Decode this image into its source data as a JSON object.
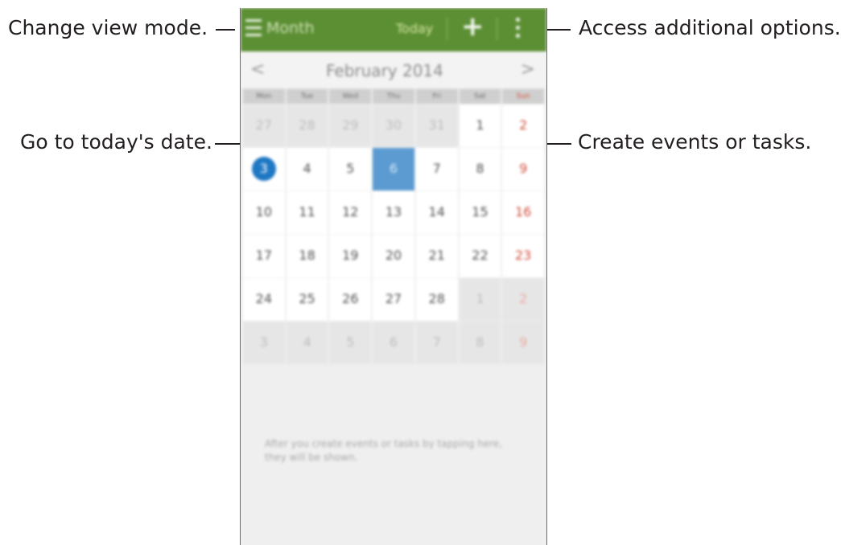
{
  "callouts": {
    "view_mode": "Change view mode.",
    "today": "Go to today's date.",
    "more_options": "Access additional options.",
    "create": "Create events or tasks."
  },
  "action_bar": {
    "view_label": "Month",
    "today_label": "Today",
    "add_icon": "plus-icon",
    "menu_icon": "hamburger-icon",
    "more_icon": "more-vertical-icon",
    "color": "#5c8f34"
  },
  "month_bar": {
    "label": "February 2014",
    "prev": "<",
    "next": ">"
  },
  "weekdays": [
    "Mon",
    "Tue",
    "Wed",
    "Thu",
    "Fri",
    "Sat",
    "Sun"
  ],
  "weeks": [
    [
      "27",
      "28",
      "29",
      "30",
      "31",
      "1",
      "2"
    ],
    [
      "3",
      "4",
      "5",
      "6",
      "7",
      "8",
      "9"
    ],
    [
      "10",
      "11",
      "12",
      "13",
      "14",
      "15",
      "16"
    ],
    [
      "17",
      "18",
      "19",
      "20",
      "21",
      "22",
      "23"
    ],
    [
      "24",
      "25",
      "26",
      "27",
      "28",
      "1",
      "2"
    ],
    [
      "3",
      "4",
      "5",
      "6",
      "7",
      "8",
      "9"
    ]
  ],
  "empty_message": "After you create events or tasks by tapping here, they will be shown.",
  "colors": {
    "today_circle": "#1f78c4",
    "selected_cell": "#5b9bd2",
    "sunday_text": "#cf4b3a"
  }
}
